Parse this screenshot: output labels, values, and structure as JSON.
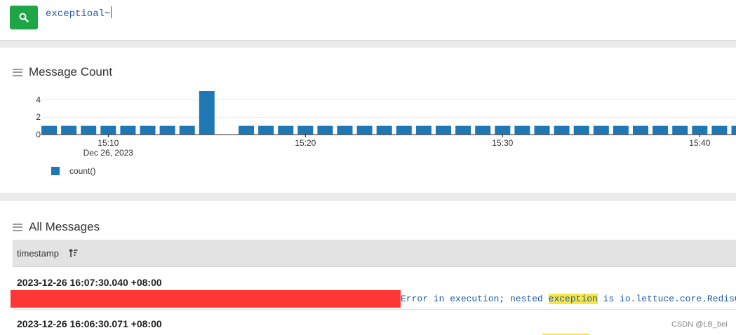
{
  "search": {
    "query": "exceptioal~",
    "button_icon": "search-icon"
  },
  "chart_panel": {
    "title": "Message Count",
    "menu_icon": "hamburger-menu-icon"
  },
  "chart_data": {
    "type": "bar",
    "title": "Message Count",
    "series": [
      {
        "name": "count()",
        "color": "#1f77b4",
        "values": [
          1,
          1,
          1,
          1,
          1,
          1,
          1,
          1,
          5,
          1,
          1,
          1,
          1,
          1,
          1,
          1,
          1,
          1,
          1,
          1,
          1,
          1,
          1,
          1,
          1,
          1,
          1,
          1,
          1,
          1,
          1,
          1,
          1,
          1,
          1,
          1
        ]
      }
    ],
    "minutes": [
      7,
      8,
      9,
      10,
      11,
      12,
      13,
      14,
      15,
      17,
      18,
      19,
      20,
      21,
      22,
      23,
      24,
      25,
      26,
      27,
      28,
      29,
      30,
      31,
      32,
      33,
      34,
      35,
      36,
      37,
      38,
      39,
      40,
      41,
      42,
      43
    ],
    "x_ticks": [
      {
        "minute": 10,
        "label": "15:10",
        "sub": "Dec 26, 2023"
      },
      {
        "minute": 20,
        "label": "15:20"
      },
      {
        "minute": 30,
        "label": "15:30"
      },
      {
        "minute": 40,
        "label": "15:40"
      }
    ],
    "y_ticks": [
      0,
      2,
      4
    ],
    "ylim": [
      0,
      5
    ],
    "xlabel": "",
    "ylabel": "",
    "grid": true,
    "legend": "bottom-left"
  },
  "messages_panel": {
    "title": "All Messages",
    "menu_icon": "hamburger-menu-icon",
    "columns": [
      {
        "label": "timestamp",
        "sort_icon": "sort-descending-icon"
      }
    ],
    "rows": [
      {
        "timestamp": "2023-12-26 16:07:30.040 +08:00",
        "message_before": "Error in execution; nested ",
        "message_highlight": "exception",
        "message_after": " is io.lettuce.core.RedisCom"
      },
      {
        "timestamp": "2023-12-26 16:06:30.071 +08:00"
      }
    ]
  },
  "watermark": "CSDN @LB_bei"
}
